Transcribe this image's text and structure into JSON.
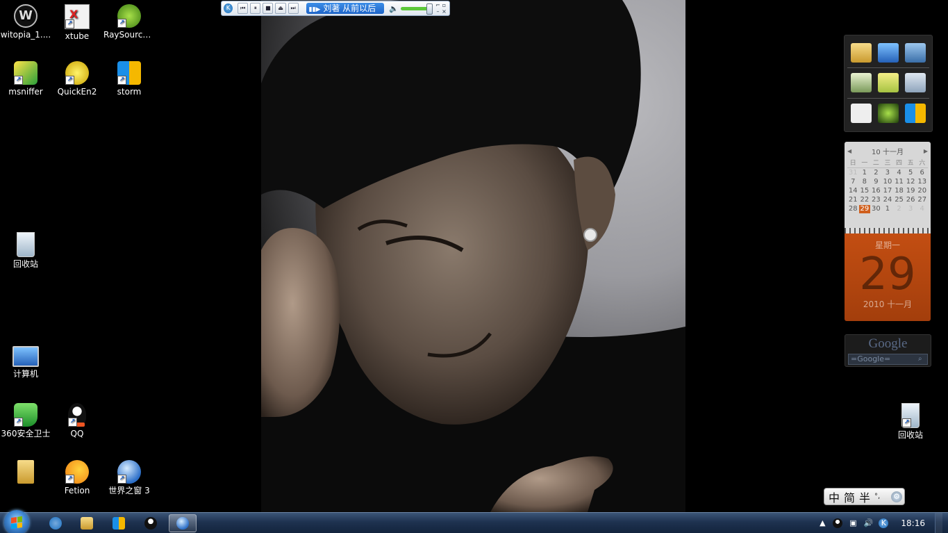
{
  "desktop": {
    "icons": [
      {
        "label": "witopia_1...."
      },
      {
        "label": "xtube"
      },
      {
        "label": "RaySource..."
      },
      {
        "label": "msniffer"
      },
      {
        "label": "QuickEn2"
      },
      {
        "label": "storm"
      },
      {
        "label": "回收站"
      },
      {
        "label": "计算机"
      },
      {
        "label": "360安全卫士"
      },
      {
        "label": "QQ"
      },
      {
        "label": ""
      },
      {
        "label": "Fetion"
      },
      {
        "label": "世界之窗 3"
      },
      {
        "label": "回收站"
      }
    ]
  },
  "media_player": {
    "track": "刘著 从前以后",
    "controls": {
      "prev": "⏮",
      "pause": "⏸",
      "stop": "■",
      "eject": "⏏",
      "next": "⏭"
    },
    "volume": 0.9
  },
  "calendar": {
    "month_label": "10 十一月",
    "weekdays": [
      "日",
      "一",
      "二",
      "三",
      "四",
      "五",
      "六"
    ],
    "days": [
      "31",
      "1",
      "2",
      "3",
      "4",
      "5",
      "6",
      "7",
      "8",
      "9",
      "10",
      "11",
      "12",
      "13",
      "14",
      "15",
      "16",
      "17",
      "18",
      "19",
      "20",
      "21",
      "22",
      "23",
      "24",
      "25",
      "26",
      "27",
      "28",
      "29",
      "30",
      "1",
      "2",
      "3",
      "4"
    ],
    "today": "29",
    "weekday_name": "星期一",
    "big_date": "29",
    "year_month": "2010 十一月"
  },
  "google_gadget": {
    "logo": "Google",
    "search_placeholder": "=Google="
  },
  "ime": {
    "zh": "中",
    "mode": "简",
    "width": "半",
    "punct": "°,"
  },
  "taskbar": {
    "clock": "18:16"
  },
  "colors": {
    "taskbar": "#1e3250",
    "calendar_accent": "#c34e12",
    "media_track_bg": "#2a77d9"
  }
}
